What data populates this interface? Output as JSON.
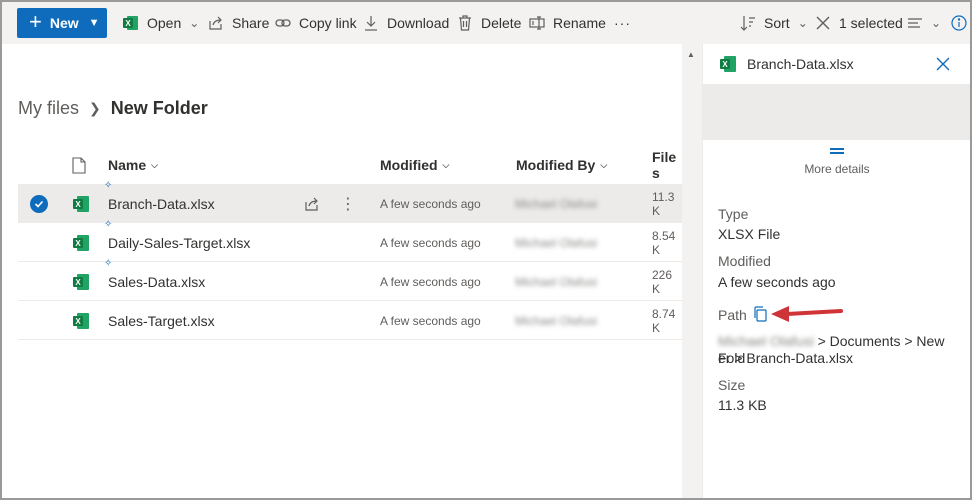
{
  "command_bar": {
    "new_label": "New",
    "open_label": "Open",
    "share_label": "Share",
    "copy_link_label": "Copy link",
    "download_label": "Download",
    "delete_label": "Delete",
    "rename_label": "Rename",
    "more_label": "···",
    "sort_label": "Sort",
    "selected_label": "1 selected"
  },
  "breadcrumb": {
    "root": "My files",
    "current": "New Folder"
  },
  "columns": {
    "name": "Name",
    "modified": "Modified",
    "modified_by": "Modified By",
    "file_size": "File s"
  },
  "files": [
    {
      "name": "Branch-Data.xlsx",
      "modified": "A few seconds ago",
      "modified_by": "Michael Olafusi",
      "size": "11.3 K",
      "selected": true
    },
    {
      "name": "Daily-Sales-Target.xlsx",
      "modified": "A few seconds ago",
      "modified_by": "Michael Olafusi",
      "size": "8.54 K",
      "selected": false
    },
    {
      "name": "Sales-Data.xlsx",
      "modified": "A few seconds ago",
      "modified_by": "Michael Olafusi",
      "size": "226 K",
      "selected": false
    },
    {
      "name": "Sales-Target.xlsx",
      "modified": "A few seconds ago",
      "modified_by": "Michael Olafusi",
      "size": "8.74 K",
      "selected": false
    }
  ],
  "details": {
    "title": "Branch-Data.xlsx",
    "more_details": "More details",
    "type_label": "Type",
    "type_value": "XLSX File",
    "modified_label": "Modified",
    "modified_value": "A few seconds ago",
    "path_label": "Path",
    "path_owner": "Michael Olafusi",
    "path_line1": "> Documents > New Fold",
    "path_line2": "er > Branch-Data.xlsx",
    "size_label": "Size",
    "size_value": "11.3 KB"
  },
  "colors": {
    "accent": "#0f6cbd",
    "excel_green": "#107c41",
    "arrow_red": "#d13438"
  }
}
